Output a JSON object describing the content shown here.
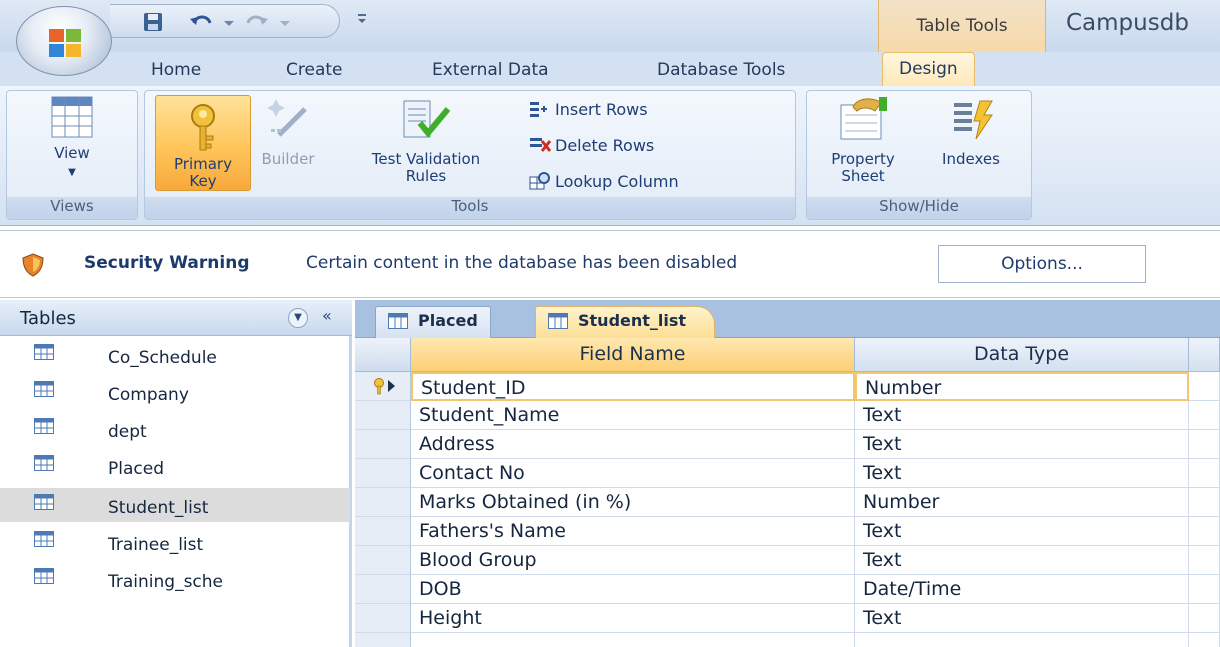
{
  "window": {
    "context_tab": "Table Tools",
    "app_title": "Campusdb"
  },
  "ribbon": {
    "tabs": [
      "Home",
      "Create",
      "External Data",
      "Database Tools",
      "Design"
    ],
    "active_tab": "Design",
    "groups": {
      "views": {
        "label": "Views",
        "view_button": "View"
      },
      "tools": {
        "label": "Tools",
        "primary_key_line1": "Primary",
        "primary_key_line2": "Key",
        "builder": "Builder",
        "test_validation_line1": "Test Validation",
        "test_validation_line2": "Rules",
        "insert_rows": "Insert Rows",
        "delete_rows": "Delete Rows",
        "lookup_column": "Lookup Column"
      },
      "show_hide": {
        "label": "Show/Hide",
        "property_sheet_line1": "Property",
        "property_sheet_line2": "Sheet",
        "indexes": "Indexes"
      }
    }
  },
  "security_bar": {
    "title": "Security Warning",
    "message": "Certain content in the database has been disabled",
    "options_button": "Options..."
  },
  "nav_pane": {
    "title": "Tables",
    "collapse_glyph": "«",
    "items": [
      {
        "label": "Co_Schedule"
      },
      {
        "label": "Company"
      },
      {
        "label": "dept"
      },
      {
        "label": "Placed"
      },
      {
        "label": "Student_list"
      },
      {
        "label": "Trainee_list"
      },
      {
        "label": "Training_sche"
      }
    ],
    "selected": "Student_list"
  },
  "document": {
    "tabs": [
      {
        "label": "Placed",
        "active": false
      },
      {
        "label": "Student_list",
        "active": true
      }
    ],
    "columns": {
      "field_name": "Field Name",
      "data_type": "Data Type"
    },
    "rows": [
      {
        "field": "Student_ID",
        "type": "Number",
        "primary_key": true
      },
      {
        "field": "Student_Name",
        "type": "Text"
      },
      {
        "field": "Address",
        "type": "Text"
      },
      {
        "field": "Contact No",
        "type": "Text"
      },
      {
        "field": "Marks Obtained (in %)",
        "type": "Number"
      },
      {
        "field": "Fathers's Name",
        "type": "Text"
      },
      {
        "field": "Blood Group",
        "type": "Text"
      },
      {
        "field": "DOB",
        "type": "Date/Time"
      },
      {
        "field": "Height",
        "type": "Text"
      },
      {
        "field": "",
        "type": ""
      }
    ]
  },
  "colors": {
    "ribbon_blue": "#dfe9f6",
    "active_orange": "#fbcf74",
    "text_blue": "#1e3d73"
  }
}
